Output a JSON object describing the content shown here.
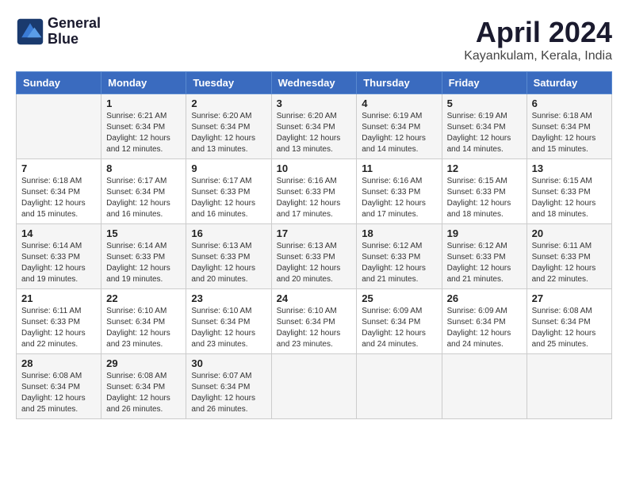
{
  "logo": {
    "line1": "General",
    "line2": "Blue"
  },
  "title": "April 2024",
  "location": "Kayankulam, Kerala, India",
  "headers": [
    "Sunday",
    "Monday",
    "Tuesday",
    "Wednesday",
    "Thursday",
    "Friday",
    "Saturday"
  ],
  "weeks": [
    [
      {
        "day": "",
        "info": ""
      },
      {
        "day": "1",
        "info": "Sunrise: 6:21 AM\nSunset: 6:34 PM\nDaylight: 12 hours\nand 12 minutes."
      },
      {
        "day": "2",
        "info": "Sunrise: 6:20 AM\nSunset: 6:34 PM\nDaylight: 12 hours\nand 13 minutes."
      },
      {
        "day": "3",
        "info": "Sunrise: 6:20 AM\nSunset: 6:34 PM\nDaylight: 12 hours\nand 13 minutes."
      },
      {
        "day": "4",
        "info": "Sunrise: 6:19 AM\nSunset: 6:34 PM\nDaylight: 12 hours\nand 14 minutes."
      },
      {
        "day": "5",
        "info": "Sunrise: 6:19 AM\nSunset: 6:34 PM\nDaylight: 12 hours\nand 14 minutes."
      },
      {
        "day": "6",
        "info": "Sunrise: 6:18 AM\nSunset: 6:34 PM\nDaylight: 12 hours\nand 15 minutes."
      }
    ],
    [
      {
        "day": "7",
        "info": ""
      },
      {
        "day": "8",
        "info": "Sunrise: 6:17 AM\nSunset: 6:34 PM\nDaylight: 12 hours\nand 16 minutes."
      },
      {
        "day": "9",
        "info": "Sunrise: 6:17 AM\nSunset: 6:33 PM\nDaylight: 12 hours\nand 16 minutes."
      },
      {
        "day": "10",
        "info": "Sunrise: 6:16 AM\nSunset: 6:33 PM\nDaylight: 12 hours\nand 17 minutes."
      },
      {
        "day": "11",
        "info": "Sunrise: 6:16 AM\nSunset: 6:33 PM\nDaylight: 12 hours\nand 17 minutes."
      },
      {
        "day": "12",
        "info": "Sunrise: 6:15 AM\nSunset: 6:33 PM\nDaylight: 12 hours\nand 18 minutes."
      },
      {
        "day": "13",
        "info": "Sunrise: 6:15 AM\nSunset: 6:33 PM\nDaylight: 12 hours\nand 18 minutes."
      }
    ],
    [
      {
        "day": "14",
        "info": ""
      },
      {
        "day": "15",
        "info": "Sunrise: 6:14 AM\nSunset: 6:33 PM\nDaylight: 12 hours\nand 19 minutes."
      },
      {
        "day": "16",
        "info": "Sunrise: 6:13 AM\nSunset: 6:33 PM\nDaylight: 12 hours\nand 20 minutes."
      },
      {
        "day": "17",
        "info": "Sunrise: 6:13 AM\nSunset: 6:33 PM\nDaylight: 12 hours\nand 20 minutes."
      },
      {
        "day": "18",
        "info": "Sunrise: 6:12 AM\nSunset: 6:33 PM\nDaylight: 12 hours\nand 21 minutes."
      },
      {
        "day": "19",
        "info": "Sunrise: 6:12 AM\nSunset: 6:33 PM\nDaylight: 12 hours\nand 21 minutes."
      },
      {
        "day": "20",
        "info": "Sunrise: 6:11 AM\nSunset: 6:33 PM\nDaylight: 12 hours\nand 22 minutes."
      }
    ],
    [
      {
        "day": "21",
        "info": ""
      },
      {
        "day": "22",
        "info": "Sunrise: 6:10 AM\nSunset: 6:34 PM\nDaylight: 12 hours\nand 23 minutes."
      },
      {
        "day": "23",
        "info": "Sunrise: 6:10 AM\nSunset: 6:34 PM\nDaylight: 12 hours\nand 23 minutes."
      },
      {
        "day": "24",
        "info": "Sunrise: 6:10 AM\nSunset: 6:34 PM\nDaylight: 12 hours\nand 23 minutes."
      },
      {
        "day": "25",
        "info": "Sunrise: 6:09 AM\nSunset: 6:34 PM\nDaylight: 12 hours\nand 24 minutes."
      },
      {
        "day": "26",
        "info": "Sunrise: 6:09 AM\nSunset: 6:34 PM\nDaylight: 12 hours\nand 24 minutes."
      },
      {
        "day": "27",
        "info": "Sunrise: 6:08 AM\nSunset: 6:34 PM\nDaylight: 12 hours\nand 25 minutes."
      }
    ],
    [
      {
        "day": "28",
        "info": ""
      },
      {
        "day": "29",
        "info": "Sunrise: 6:08 AM\nSunset: 6:34 PM\nDaylight: 12 hours\nand 26 minutes."
      },
      {
        "day": "30",
        "info": "Sunrise: 6:07 AM\nSunset: 6:34 PM\nDaylight: 12 hours\nand 26 minutes."
      },
      {
        "day": "",
        "info": ""
      },
      {
        "day": "",
        "info": ""
      },
      {
        "day": "",
        "info": ""
      },
      {
        "day": "",
        "info": ""
      }
    ]
  ],
  "week1_sunday_info": "Sunrise: 6:18 AM\nSunset: 6:34 PM\nDaylight: 12 hours\nand 15 minutes.",
  "week2_sunday_info": "Sunrise: 6:18 AM\nSunset: 6:34 PM\nDaylight: 12 hours\nand 15 minutes.",
  "week3_sunday_info": "Sunrise: 6:14 AM\nSunset: 6:33 PM\nDaylight: 12 hours\nand 19 minutes.",
  "week4_sunday_info": "Sunrise: 6:11 AM\nSunset: 6:33 PM\nDaylight: 12 hours\nand 22 minutes.",
  "week5_sunday_info": "Sunrise: 6:08 AM\nSunset: 6:34 PM\nDaylight: 12 hours\nand 25 minutes."
}
